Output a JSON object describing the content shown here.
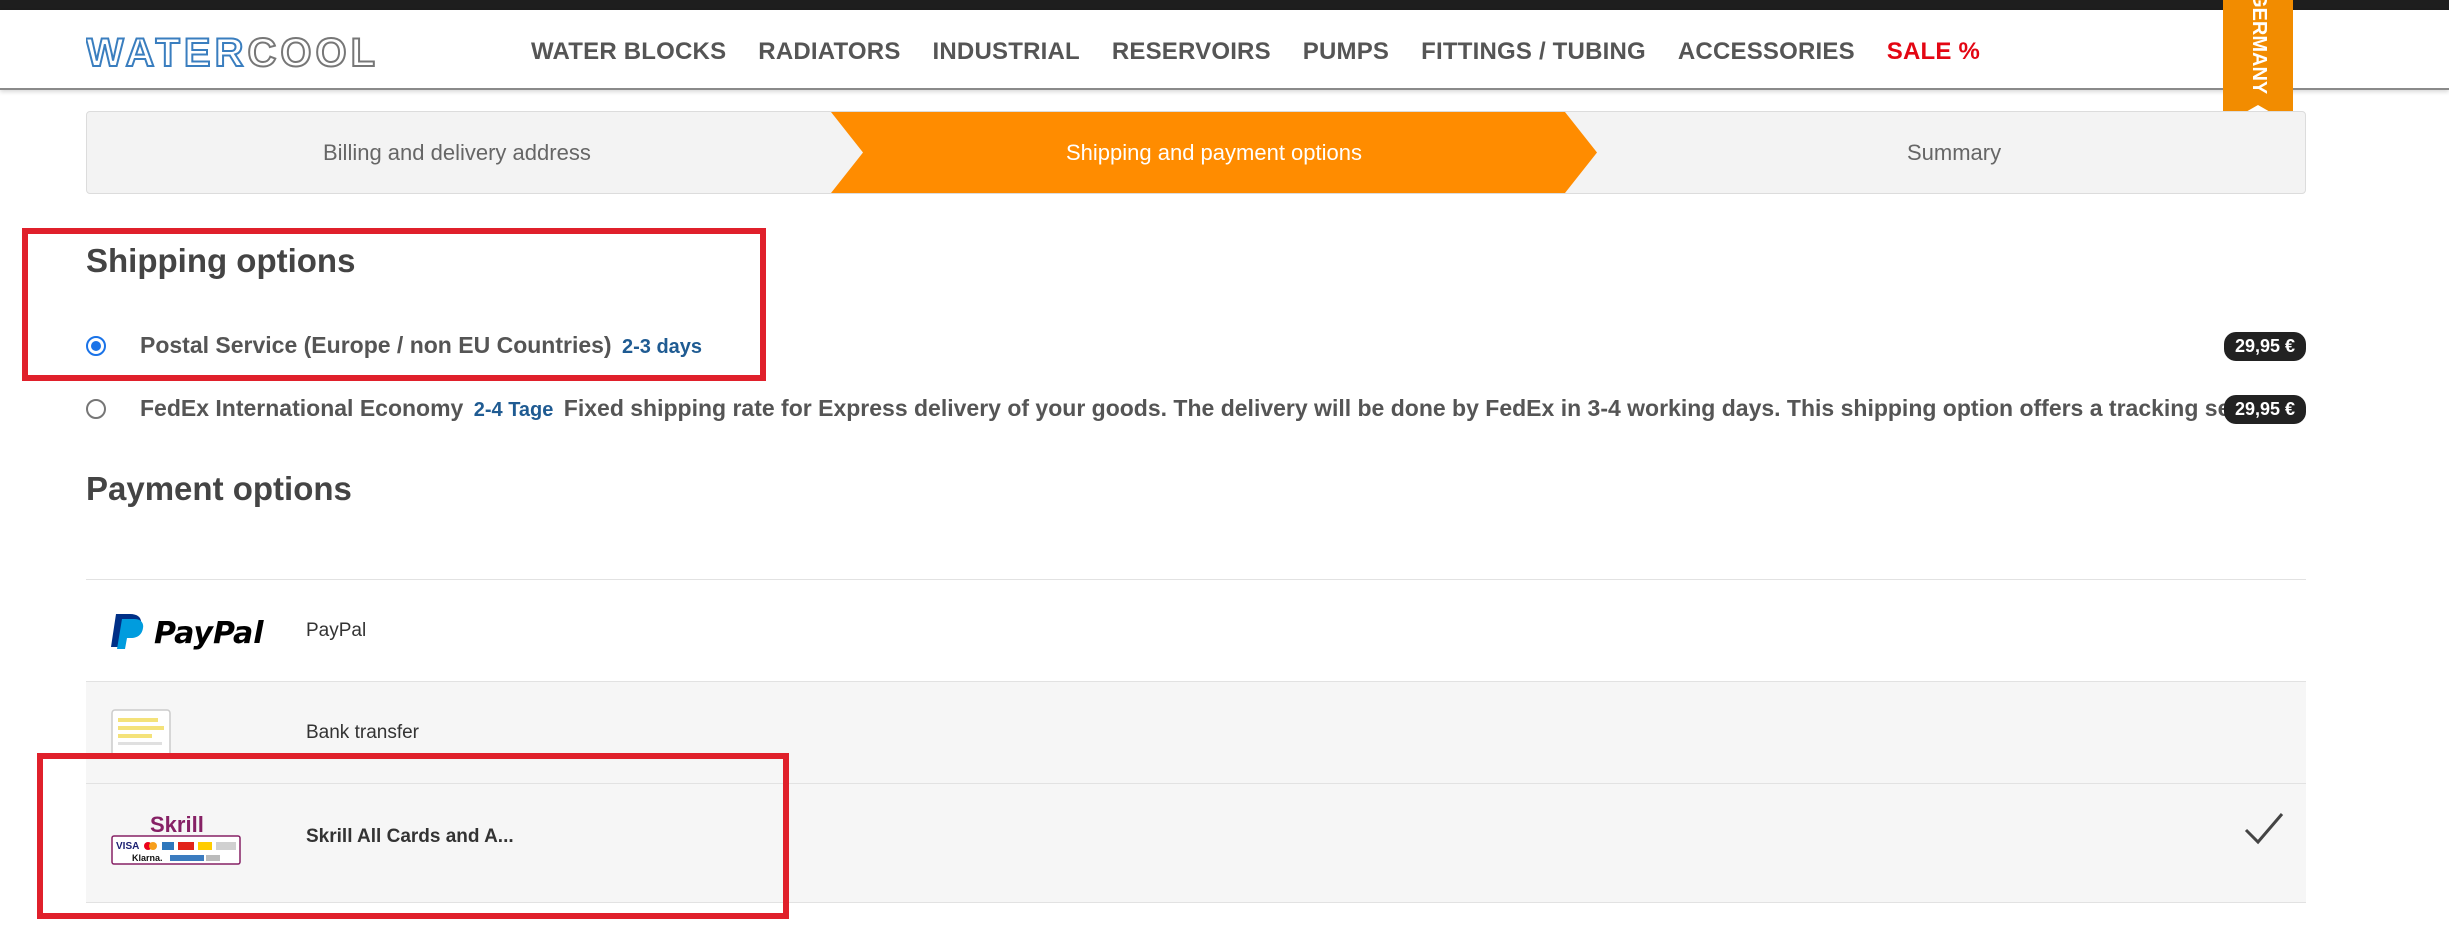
{
  "brand": {
    "logo_text": "WATERCOOL",
    "ribbon_text": "MADE IN GERMANY",
    "accent_color": "#ff8c00",
    "sale_color": "#e30613"
  },
  "nav": {
    "items": [
      {
        "label": "WATER BLOCKS"
      },
      {
        "label": "RADIATORS"
      },
      {
        "label": "INDUSTRIAL"
      },
      {
        "label": "RESERVOIRS"
      },
      {
        "label": "PUMPS"
      },
      {
        "label": "FITTINGS / TUBING"
      },
      {
        "label": "ACCESSORIES"
      },
      {
        "label": "SALE %"
      }
    ]
  },
  "checkout_steps": {
    "step1": "Billing and delivery address",
    "step2": "Shipping and payment options",
    "step3": "Summary",
    "active_step": 2
  },
  "shipping": {
    "title": "Shipping options",
    "options": [
      {
        "name": "Postal Service (Europe / non EU Countries)",
        "days": "2-3 days",
        "description": "",
        "price": "29,95 €",
        "selected": true
      },
      {
        "name": "FedEx International Economy",
        "days": "2-4 Tage",
        "description": "Fixed shipping rate for Express delivery of your goods. The delivery will be done by FedEx in 3-4 working days. This shipping option offers a tracking service.",
        "price": "29,95 €",
        "selected": false
      }
    ]
  },
  "payment": {
    "title": "Payment options",
    "options": [
      {
        "label": "PayPal",
        "logo_text": "PayPal",
        "icon": "paypal-logo",
        "selected": false
      },
      {
        "label": "Bank transfer",
        "icon": "bank-transfer-icon",
        "selected": false
      },
      {
        "label": "Skrill All Cards and A...",
        "logo_text": "Skrill",
        "card_text": "VISA",
        "card_text2": "Klarna.",
        "icon": "skrill-logo",
        "selected": true
      }
    ],
    "selected_icon": "checkmark-icon"
  }
}
